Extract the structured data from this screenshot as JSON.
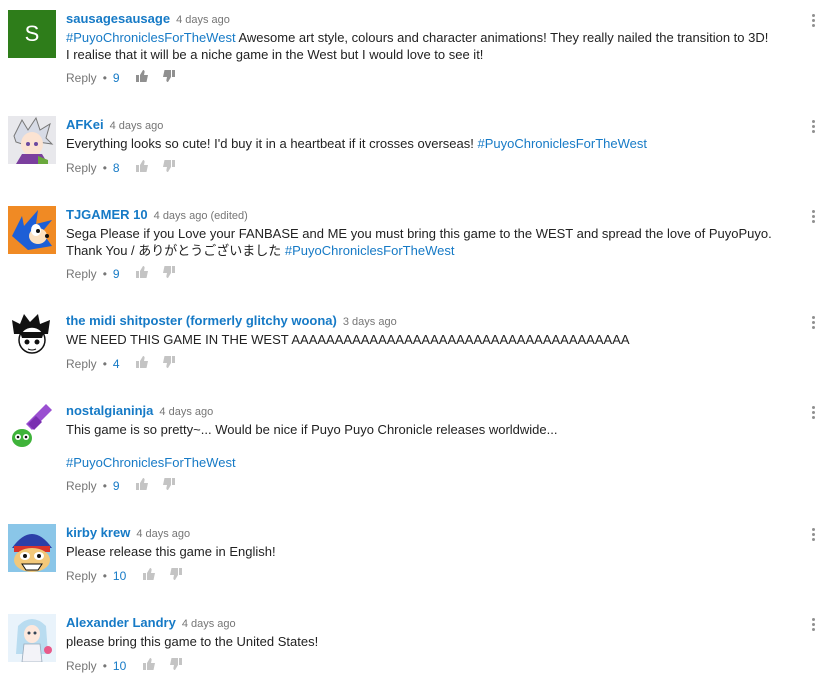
{
  "reply_label": "Reply",
  "dot": "•",
  "comments": [
    {
      "author": "sausagesausage",
      "time": "4 days ago",
      "avatar": "letter",
      "avatar_letter": "S",
      "line1_tag": "#PuyoChroniclesForTheWest",
      "line1": "  Awesome art style, colours and character animations! They really nailed the transition to 3D!",
      "line2": "I realise that it will be a niche game in the West but I would love to see it!",
      "likes": "9"
    },
    {
      "author": "AFKei",
      "time": "4 days ago",
      "avatar": "anime-boy",
      "line1": "Everything looks so cute! I'd buy it in a heartbeat if it crosses overseas! ",
      "line1_tag": "#PuyoChroniclesForTheWest",
      "likes": "8"
    },
    {
      "author": "TJGAMER 10",
      "time": "4 days ago (edited)",
      "avatar": "sonic",
      "line1": "Sega Please if you Love your FANBASE and ME you must bring this game to the WEST and spread the love of PuyoPuyo.",
      "line2": "Thank You / ありがとうございました  ",
      "line2_tag": "#PuyoChroniclesForTheWest",
      "likes": "9"
    },
    {
      "author": "the midi shitposter (formerly glitchy woona)",
      "time": "3 days ago",
      "avatar": "drawn-boy",
      "line1": "WE NEED THIS GAME IN THE WEST AAAAAAAAAAAAAAAAAAAAAAAAAAAAAAAAAAAAAAA",
      "likes": "4"
    },
    {
      "author": "nostalgianinja",
      "time": "4 days ago",
      "avatar": "puyo",
      "line1": "This game is so pretty~...  Would be nice if Puyo Puyo Chronicle releases worldwide...",
      "line3_tag": "#PuyoChroniclesForTheWest",
      "likes": "9"
    },
    {
      "author": "kirby krew",
      "time": "4 days ago",
      "avatar": "dedede",
      "line1": "Please release this game in English!",
      "likes": "10"
    },
    {
      "author": "Alexander Landry",
      "time": "4 days ago",
      "avatar": "anime-girl",
      "line1": "please bring this game to the United States!",
      "likes": "10"
    }
  ]
}
